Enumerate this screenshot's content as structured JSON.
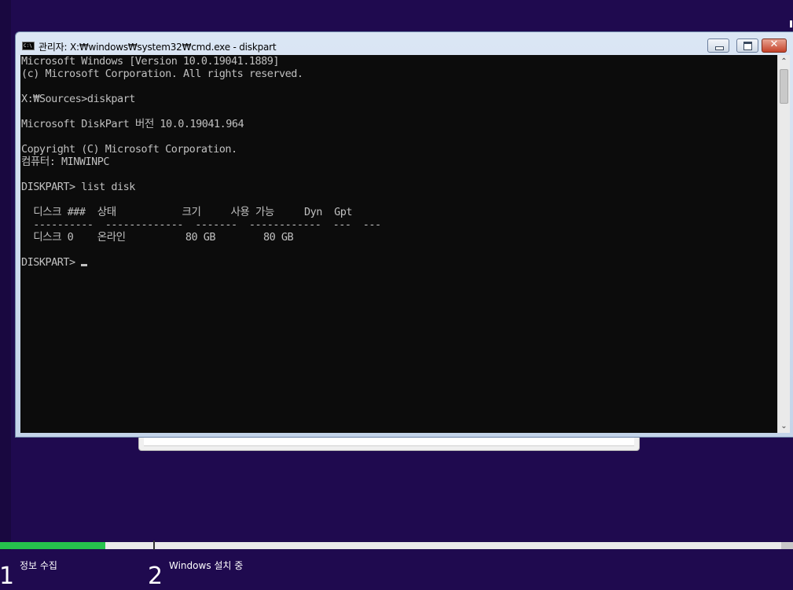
{
  "window": {
    "title": "관리자: X:₩windows₩system32₩cmd.exe - diskpart",
    "icon": "cmd-icon",
    "close_glyph": "✕"
  },
  "console": {
    "lines": [
      "Microsoft Windows [Version 10.0.19041.1889]",
      "(c) Microsoft Corporation. All rights reserved.",
      "",
      "X:₩Sources>diskpart",
      "",
      "Microsoft DiskPart 버전 10.0.19041.964",
      "",
      "Copyright (C) Microsoft Corporation.",
      "컴퓨터: MINWINPC",
      "",
      "DISKPART> list disk",
      "",
      "  디스크 ###  상태           크기     사용 가능     Dyn  Gpt",
      "  ----------  -------------  -------  ------------  ---  ---",
      "  디스크 0    온라인          80 GB        80 GB",
      ""
    ],
    "prompt": "DISKPART> "
  },
  "scrollbar": {
    "up_glyph": "⌃",
    "down_glyph": "⌄"
  },
  "setup": {
    "progress_fraction": 0.135,
    "steps": [
      {
        "number": "1",
        "label": "정보 수집"
      },
      {
        "number": "2",
        "label": "Windows 설치 중"
      }
    ]
  },
  "colors": {
    "background": "#1f0a4f",
    "console_bg": "#0c0c0c",
    "console_text": "#c0c0c0",
    "progress": "#26c24d"
  }
}
